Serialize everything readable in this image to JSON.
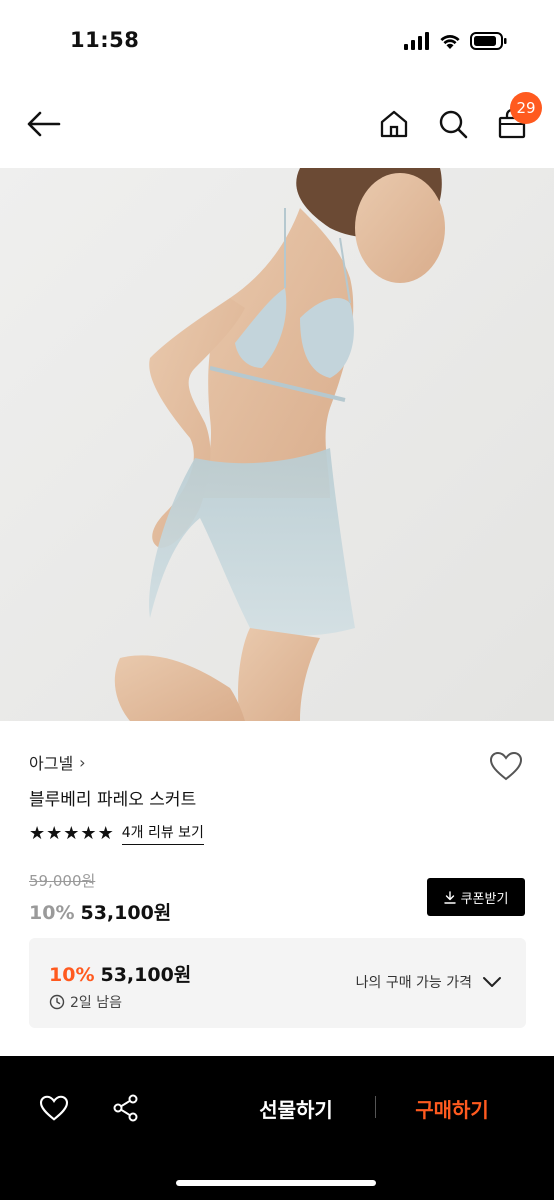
{
  "status_bar": {
    "time": "11:58"
  },
  "header": {
    "cart_count": "29"
  },
  "product": {
    "brand": "아그넬",
    "brand_chevron": "›",
    "name": "블루베리 파레오 스커트",
    "rating": 5,
    "review_link": "4개 리뷰 보기",
    "original_price": "59,000원",
    "discount_rate": "10%",
    "sale_price": "53,100원",
    "coupon_label": "쿠폰받기"
  },
  "my_price": {
    "discount_rate": "10%",
    "price": "53,100원",
    "remaining": "2일 남음",
    "toggle_label": "나의 구매 가능 가격"
  },
  "bottom_bar": {
    "gift_label": "선물하기",
    "buy_label": "구매하기"
  },
  "colors": {
    "accent": "#ff5a1f",
    "muted": "#9a9a9a",
    "bottom_bg": "#000000"
  },
  "icons": [
    "back-arrow-icon",
    "home-icon",
    "search-icon",
    "shopping-bag-icon",
    "heart-icon",
    "share-icon",
    "download-icon",
    "clock-icon",
    "chevron-down-icon"
  ]
}
